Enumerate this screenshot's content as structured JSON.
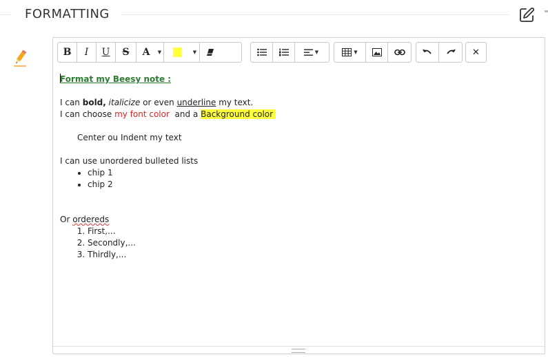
{
  "header": {
    "title": "FORMATTING"
  },
  "toolbar": {
    "bold": "B",
    "italic": "I",
    "underline": "U",
    "strike": "S",
    "font_color": "A",
    "highlight_color": "#ffff3a"
  },
  "note": {
    "title": "Format my Beesy note :",
    "line1": {
      "p1": "I can ",
      "bold": "bold,",
      "p2": " ",
      "italic": "italicize",
      "p3": " or even ",
      "underline": "underline",
      "p4": " my text."
    },
    "line2": {
      "p1": "I can choose ",
      "red": "my font color",
      "p2": "  and a ",
      "highlight": "Background color"
    },
    "centered": "Center ou Indent my text",
    "unordered_intro": "I can use unordered bulleted lists",
    "unordered_items": [
      "chip 1",
      "chip 2"
    ],
    "ordered_intro": {
      "p1": "Or ",
      "misspelled": "ordereds"
    },
    "ordered_items": [
      "First,...",
      "Secondly,...",
      "Thirdly,..."
    ]
  },
  "colors": {
    "title_green": "#2e7d32",
    "text_red": "#e02020",
    "highlight_yellow": "#ffff3a"
  }
}
